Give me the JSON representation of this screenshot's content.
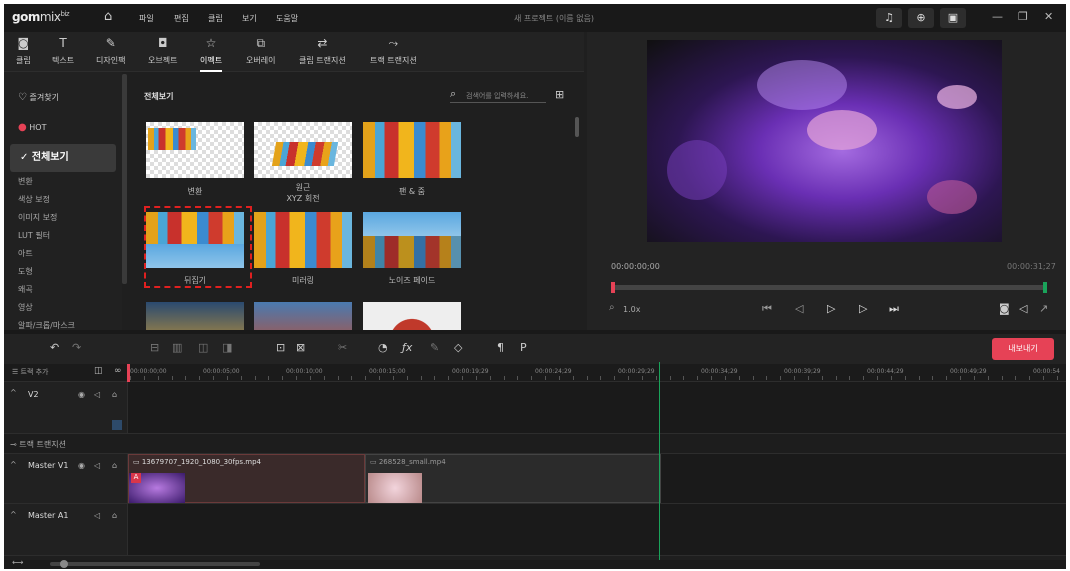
{
  "app": {
    "logo": "gom",
    "logo_sub": "mix",
    "logo_badge": "biz",
    "window_title": "새 프로젝트 (이름 없음)",
    "menu": [
      "파일",
      "편집",
      "클립",
      "보기",
      "도움말"
    ],
    "accent": "#e64256",
    "playhead_color": "#1aa35a"
  },
  "toolbar": {
    "items": [
      {
        "label": "클립",
        "icon": "clip-icon"
      },
      {
        "label": "텍스트",
        "icon": "text-icon"
      },
      {
        "label": "디자인팩",
        "icon": "design-pack-icon"
      },
      {
        "label": "오브젝트",
        "icon": "object-icon"
      },
      {
        "label": "이펙트",
        "icon": "effect-icon",
        "active": true
      },
      {
        "label": "오버레이",
        "icon": "overlay-icon"
      },
      {
        "label": "클립 트랜지션",
        "icon": "clip-transition-icon"
      },
      {
        "label": "트랙 트랜지션",
        "icon": "track-transition-icon"
      }
    ]
  },
  "sidebar": {
    "favorites": "즐겨찾기",
    "hot": "HOT",
    "selected": "전체보기",
    "items": [
      "변환",
      "색상 보정",
      "이미지 보정",
      "LUT 필터",
      "아트",
      "도형",
      "왜곡",
      "영상",
      "알파/크롭/마스크"
    ]
  },
  "grid": {
    "title": "전체보기",
    "search_placeholder": "검색어를 입력하세요.",
    "thumbs": [
      {
        "label": "변환"
      },
      {
        "label": "원근",
        "label2": "XYZ 회전"
      },
      {
        "label": "팬 & 줌"
      },
      {
        "label": "뒤집기",
        "selected": true
      },
      {
        "label": "미러링"
      },
      {
        "label": "노이즈 페이드"
      }
    ]
  },
  "preview": {
    "current_time": "00:00:00;00",
    "total_time": "00:00:31;27",
    "zoom": "1.0x"
  },
  "timeline": {
    "export_label": "내보내기",
    "add_track": "트랙 추가",
    "ruler": [
      "00:00:00;00",
      "00:00:05;00",
      "00:00:10;00",
      "00:00:15;00",
      "00:00:19;29",
      "00:00:24;29",
      "00:00:29;29",
      "00:00:34;29",
      "00:00:39;29",
      "00:00:44;29",
      "00:00:49;29",
      "00:00:54"
    ],
    "tracks": {
      "v2": "V2",
      "track_transition": "트랙 트랜지션",
      "master_v1": "Master V1",
      "master_a1": "Master A1"
    },
    "clips": [
      {
        "name": "13679707_1920_1080_30fps.mp4"
      },
      {
        "name": "268528_small.mp4"
      }
    ]
  }
}
